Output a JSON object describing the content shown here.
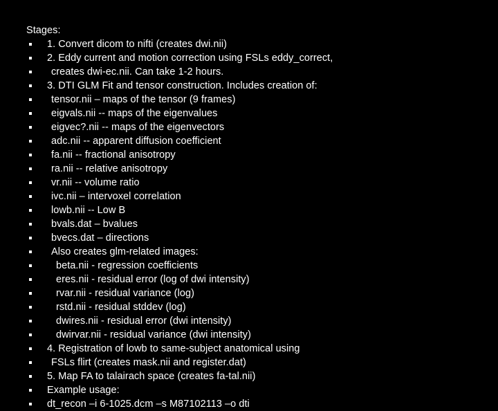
{
  "slide": {
    "background_color": "#000000",
    "text_color": "#ffffff",
    "heading": "Stages:",
    "bullet_glyph": "square-bullet",
    "items": [
      {
        "level": 1,
        "text": "1. Convert dicom to nifti (creates dwi.nii)"
      },
      {
        "level": 1,
        "text": "2. Eddy current and motion correction using FSLs eddy_correct,"
      },
      {
        "level": 2,
        "text": "creates dwi-ec.nii. Can take 1-2 hours."
      },
      {
        "level": 1,
        "text": "3. DTI GLM Fit and tensor construction. Includes creation of:"
      },
      {
        "level": 2,
        "text": "tensor.nii – maps of the tensor (9 frames)"
      },
      {
        "level": 2,
        "text": "eigvals.nii -- maps of the eigenvalues"
      },
      {
        "level": 2,
        "text": "eigvec?.nii -- maps of the eigenvectors"
      },
      {
        "level": 2,
        "text": "adc.nii -- apparent diffusion coefficient"
      },
      {
        "level": 2,
        "text": "fa.nii -- fractional anisotropy"
      },
      {
        "level": 2,
        "text": "ra.nii -- relative anisotropy"
      },
      {
        "level": 2,
        "text": "vr.nii -- volume ratio"
      },
      {
        "level": 2,
        "text": "ivc.nii – intervoxel correlation"
      },
      {
        "level": 2,
        "text": "lowb.nii -- Low B"
      },
      {
        "level": 2,
        "text": "bvals.dat – bvalues"
      },
      {
        "level": 2,
        "text": "bvecs.dat – directions"
      },
      {
        "level": 2,
        "text": "Also creates glm-related images:"
      },
      {
        "level": 3,
        "text": "beta.nii - regression coefficients"
      },
      {
        "level": 3,
        "text": "eres.nii - residual error (log of dwi intensity)"
      },
      {
        "level": 3,
        "text": "rvar.nii - residual variance (log)"
      },
      {
        "level": 3,
        "text": "rstd.nii - residual stddev (log)"
      },
      {
        "level": 3,
        "text": "dwires.nii - residual error (dwi intensity)"
      },
      {
        "level": 3,
        "text": "dwirvar.nii - residual variance (dwi intensity)"
      },
      {
        "level": 1,
        "text": "4. Registration of lowb to same-subject anatomical using"
      },
      {
        "level": 2,
        "text": "FSLs flirt (creates mask.nii and register.dat)"
      },
      {
        "level": 1,
        "text": "5. Map FA to talairach space (creates fa-tal.nii)"
      },
      {
        "level": 1,
        "text": "Example usage:"
      },
      {
        "level": 1,
        "text": "dt_recon –i 6-1025.dcm –s M87102113 –o dti"
      }
    ]
  }
}
